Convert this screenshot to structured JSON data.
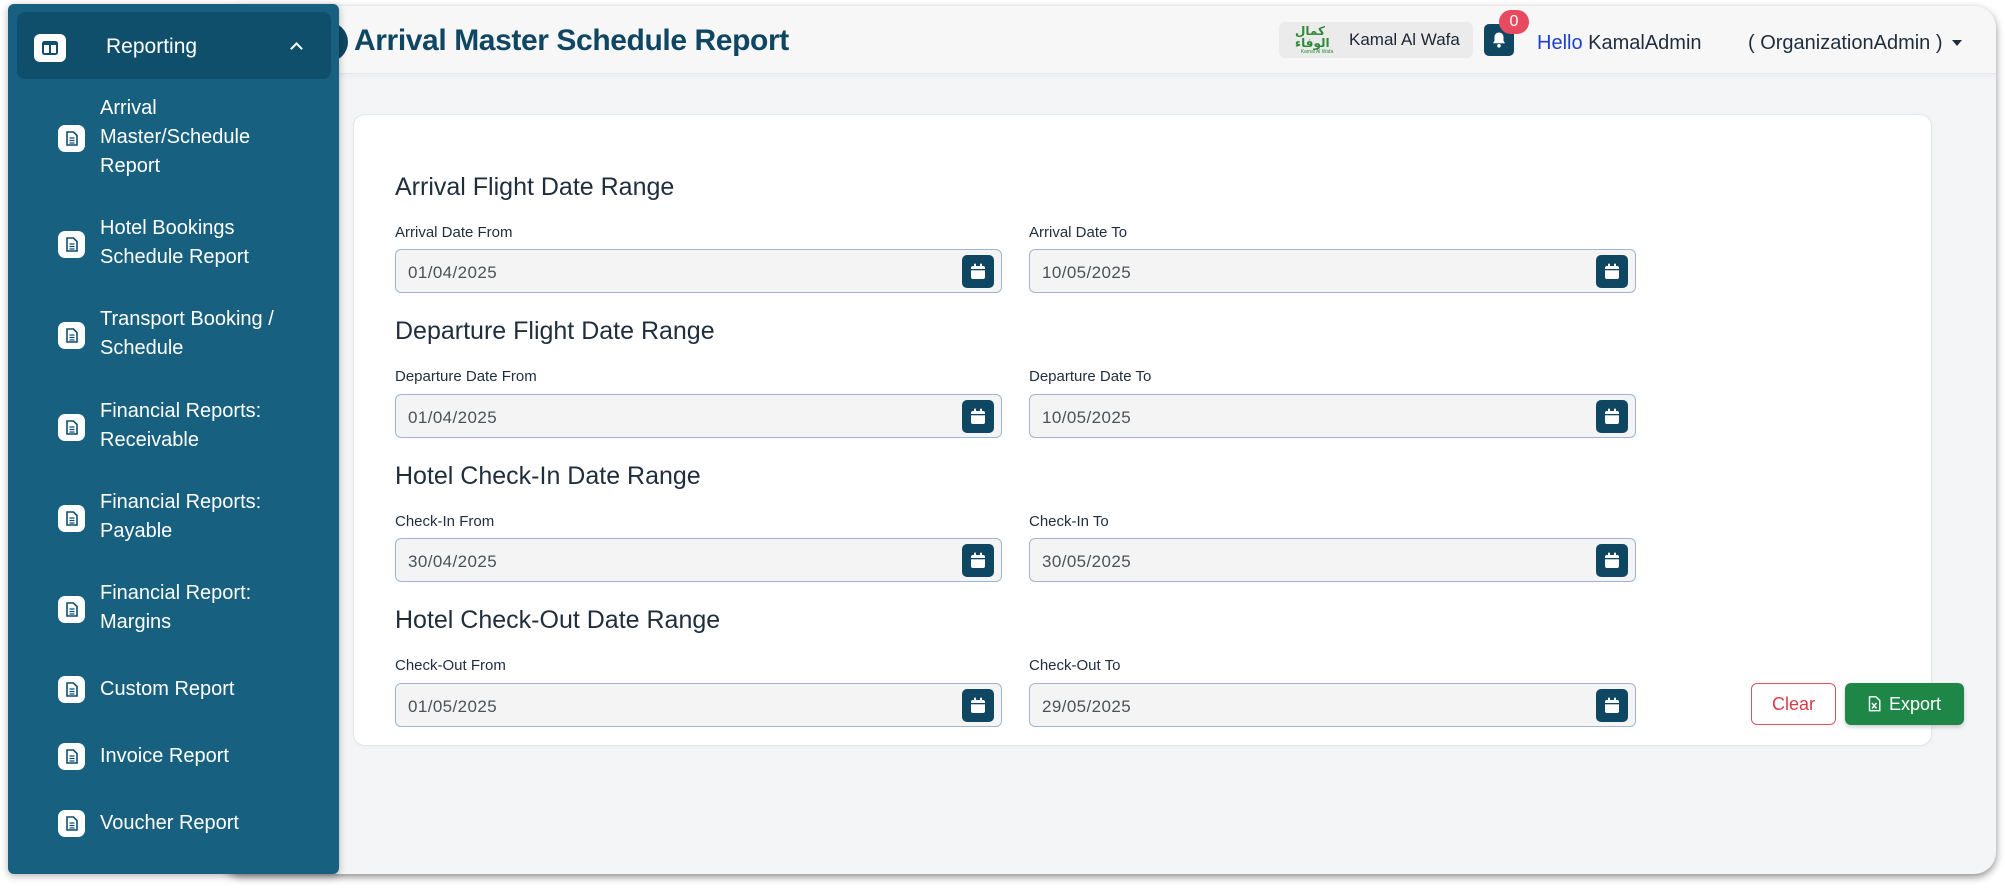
{
  "header": {
    "title": "Arrival Master Schedule Report",
    "org_name": "Kamal Al Wafa",
    "org_logo_text": "كمال الوفاء",
    "org_logo_subtext": "Kamal Al Wafa",
    "notification_count": "0",
    "greeting": "Hello",
    "username": "KamalAdmin",
    "role": "( OrganizationAdmin )"
  },
  "sidebar": {
    "section_label": "Reporting",
    "items": [
      {
        "label": "Arrival Master/Schedule Report",
        "icon": "document-icon"
      },
      {
        "label": "Hotel Bookings Schedule Report",
        "icon": "document-icon"
      },
      {
        "label": "Transport Booking / Schedule",
        "icon": "document-icon"
      },
      {
        "label": "Financial Reports: Receivable",
        "icon": "document-icon"
      },
      {
        "label": "Financial Reports: Payable",
        "icon": "document-icon"
      },
      {
        "label": "Financial Report: Margins",
        "icon": "document-icon"
      },
      {
        "label": "Custom Report",
        "icon": "document-icon"
      },
      {
        "label": "Invoice Report",
        "icon": "document-icon"
      },
      {
        "label": "Voucher Report",
        "icon": "document-icon"
      }
    ]
  },
  "form": {
    "sections": [
      {
        "title": "Arrival Flight Date Range",
        "from_label": "Arrival Date From",
        "from_value": "01/04/2025",
        "to_label": "Arrival Date To",
        "to_value": "10/05/2025"
      },
      {
        "title": "Departure Flight Date Range",
        "from_label": "Departure Date From",
        "from_value": "01/04/2025",
        "to_label": "Departure Date To",
        "to_value": "10/05/2025"
      },
      {
        "title": "Hotel Check-In Date Range",
        "from_label": "Check-In From",
        "from_value": "30/04/2025",
        "to_label": "Check-In To",
        "to_value": "30/05/2025"
      },
      {
        "title": "Hotel Check-Out Date Range",
        "from_label": "Check-Out From",
        "from_value": "01/05/2025",
        "to_label": "Check-Out To",
        "to_value": "29/05/2025"
      }
    ],
    "clear_label": "Clear",
    "export_label": "Export"
  },
  "colors": {
    "sidebar_bg": "#17607f",
    "primary": "#0f4763",
    "export_green": "#1e8748",
    "clear_red": "#d93a48",
    "badge_red": "#e84a5f"
  }
}
